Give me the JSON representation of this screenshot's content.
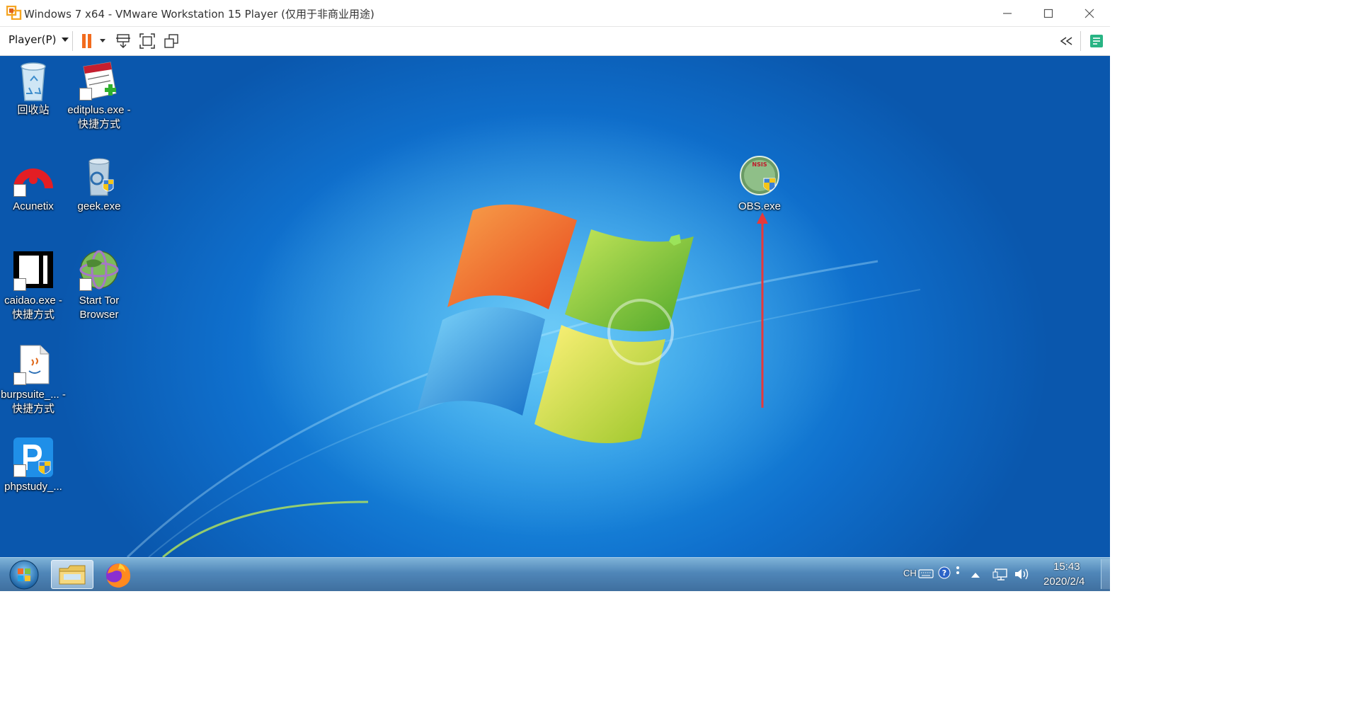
{
  "window": {
    "title": "Windows 7 x64 - VMware Workstation 15 Player (仅用于非商业用途)",
    "minimize_icon": "minimize-icon",
    "maximize_icon": "maximize-icon",
    "close_icon": "close-icon"
  },
  "toolbar": {
    "player_menu": "Player(P)",
    "pause_color": "#f26b1d",
    "icons": [
      "pause-icon",
      "send-ctrl-alt-del-icon",
      "full-screen-icon",
      "unity-icon",
      "collapse-icon",
      "message-log-icon"
    ]
  },
  "desktop": {
    "icons": [
      {
        "label": "回收站",
        "icon": "recycle-bin-icon"
      },
      {
        "label": "editplus.exe - 快捷方式",
        "icon": "editplus-icon"
      },
      {
        "label": "Acunetix",
        "icon": "acunetix-icon"
      },
      {
        "label": "geek.exe",
        "icon": "geek-icon"
      },
      {
        "label": "caidao.exe - 快捷方式",
        "icon": "caidao-icon"
      },
      {
        "label": "Start Tor Browser",
        "icon": "tor-browser-icon"
      },
      {
        "label": "burpsuite_... - 快捷方式",
        "icon": "burpsuite-icon"
      },
      {
        "label": "phpstudy_...",
        "icon": "phpstudy-icon"
      },
      {
        "label": "OBS.exe",
        "icon": "obs-icon"
      }
    ],
    "annotation_arrow_color": "#e8393a"
  },
  "taskbar": {
    "start": "windows-start-icon",
    "items": [
      "file-explorer-icon",
      "firefox-icon"
    ],
    "tray": {
      "language": "CH",
      "time": "15:43",
      "date": "2020/2/4"
    }
  }
}
